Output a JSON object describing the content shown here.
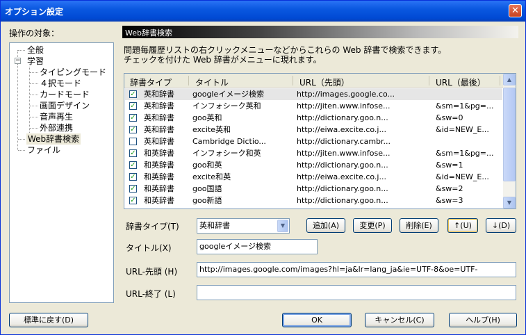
{
  "window": {
    "title": "オプション設定",
    "close_label": "✕"
  },
  "target_label": "操作の対象：",
  "tree": {
    "items": [
      {
        "label": "全般"
      },
      {
        "label": "学習",
        "expander": "−"
      },
      {
        "label": "タイピングモード"
      },
      {
        "label": "４択モード"
      },
      {
        "label": "カードモード"
      },
      {
        "label": "画面デザイン"
      },
      {
        "label": "音声再生"
      },
      {
        "label": "外部連携"
      },
      {
        "label": "Web辞書検索"
      },
      {
        "label": "ファイル"
      }
    ]
  },
  "panel": {
    "header": "Web辞書検索",
    "desc_line1": "問題毎履歴リストの右クリックメニューなどからこれらの Web 辞書で検索できます。",
    "desc_line2": "チェックを付けた Web 辞書がメニューに現れます。"
  },
  "table": {
    "columns": [
      "辞書タイプ",
      "タイトル",
      "URL（先頭）",
      "URL（最後）"
    ],
    "rows": [
      {
        "checked": true,
        "type": "英和辞書",
        "title": "googleイメージ検索",
        "url_start": "http://images.google.co...",
        "url_end": ""
      },
      {
        "checked": true,
        "type": "英和辞書",
        "title": "インフォシーク英和",
        "url_start": "http://jiten.www.infose...",
        "url_end": "&sm=1&pg=..."
      },
      {
        "checked": true,
        "type": "英和辞書",
        "title": "goo英和",
        "url_start": "http://dictionary.goo.n...",
        "url_end": "&sw=0"
      },
      {
        "checked": true,
        "type": "英和辞書",
        "title": "excite英和",
        "url_start": "http://eiwa.excite.co.j...",
        "url_end": "&id=NEW_E..."
      },
      {
        "checked": false,
        "type": "英和辞書",
        "title": "Cambridge Dictio...",
        "url_start": "http://dictionary.cambr...",
        "url_end": ""
      },
      {
        "checked": true,
        "type": "和英辞書",
        "title": "インフォシーク和英",
        "url_start": "http://jiten.www.infose...",
        "url_end": "&sm=1&pg=..."
      },
      {
        "checked": true,
        "type": "和英辞書",
        "title": "goo和英",
        "url_start": "http://dictionary.goo.n...",
        "url_end": "&sw=1"
      },
      {
        "checked": true,
        "type": "和英辞書",
        "title": "excite和英",
        "url_start": "http://eiwa.excite.co.j...",
        "url_end": "&id=NEW_E..."
      },
      {
        "checked": true,
        "type": "和英辞書",
        "title": "goo国語",
        "url_start": "http://dictionary.goo.n...",
        "url_end": "&sw=2"
      },
      {
        "checked": true,
        "type": "和英辞書",
        "title": "goo新語",
        "url_start": "http://dictionary.goo.n...",
        "url_end": "&sw=3"
      }
    ]
  },
  "form": {
    "dict_type_label": "辞書タイプ(T)",
    "dict_type_value": "英和辞書",
    "add_label": "追加(A)",
    "edit_label": "変更(P)",
    "delete_label": "削除(E)",
    "up_label": "↑(U)",
    "down_label": "↓(D)",
    "title_label": "タイトル(X)",
    "title_value": "googleイメージ検索",
    "url_start_label": "URL-先頭 (H)",
    "url_start_value": "http://images.google.com/images?hl=ja&lr=lang_ja&ie=UTF-8&oe=UTF-",
    "url_end_label": "URL-終了 (L)",
    "url_end_value": ""
  },
  "footer": {
    "reset_label": "標準に戻す(D)",
    "ok_label": "OK",
    "cancel_label": "キャンセル(C)",
    "help_label": "ヘルプ(H)"
  }
}
